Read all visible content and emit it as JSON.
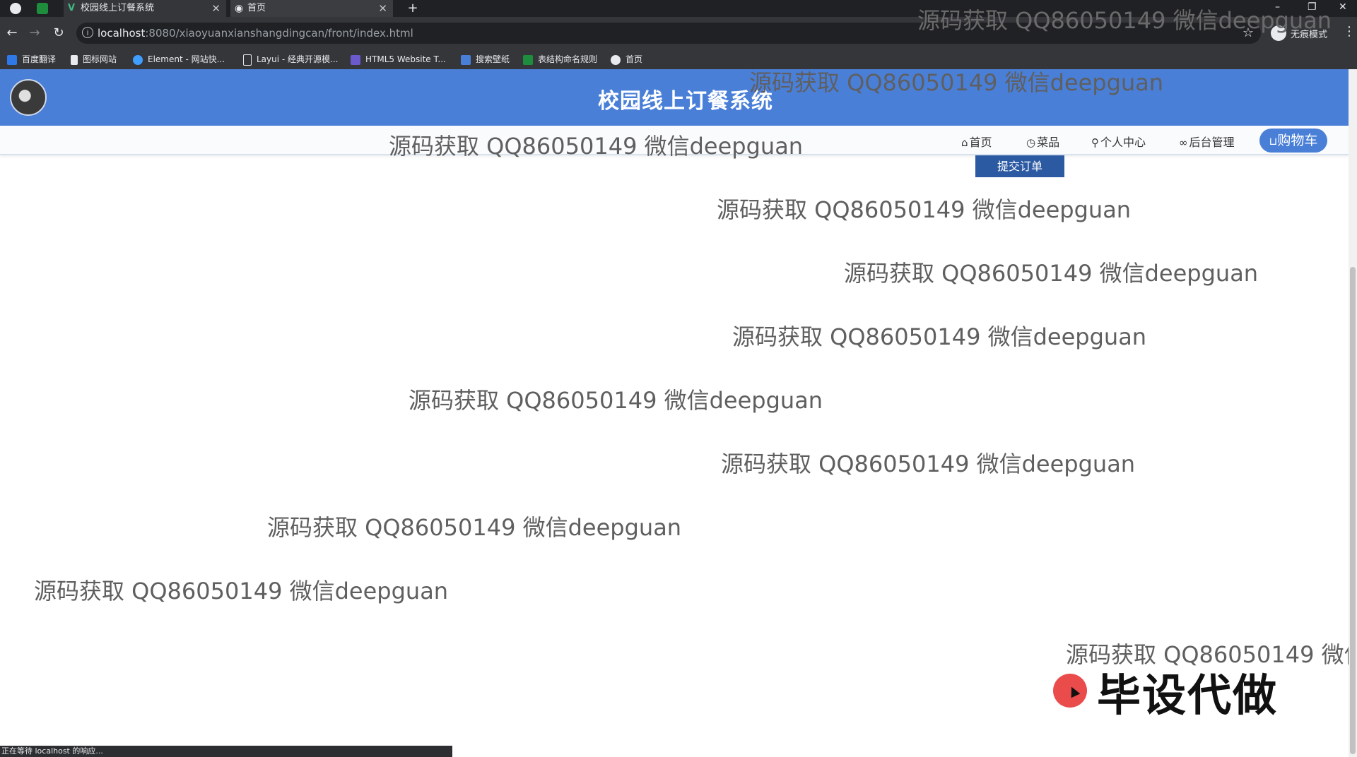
{
  "browser": {
    "tabs": [
      {
        "title": "校园线上订餐系统",
        "active": false
      },
      {
        "title": "首页",
        "active": true
      }
    ],
    "url_host": "localhost",
    "url_path": ":8080/xiaoyuanxianshangdingcan/front/index.html",
    "incognito_label": "无痕模式",
    "bookmarks": [
      "百度翻译",
      "图标网站",
      "Element - 网站快...",
      "Layui - 经典开源模...",
      "HTML5 Website T...",
      "搜索壁纸",
      "表结构命名规则",
      "首页"
    ],
    "status_text": "正在等待 localhost 的响应..."
  },
  "site": {
    "title": "校园线上订餐系统",
    "nav": {
      "home": "首页",
      "dishes": "菜品",
      "profile": "个人中心",
      "admin": "后台管理",
      "cart": "购物车"
    },
    "submit_order": "提交订单"
  },
  "overlay": {
    "watermark": "源码获取 QQ86050149 微信deepguan",
    "watermark_cut": "源码获取 QQ86050149 微信d",
    "promo": "毕设代做"
  },
  "colors": {
    "header_blue": "#4a7fd8",
    "button_blue": "#2b5aa3",
    "promo_red": "#ea4b4b"
  }
}
